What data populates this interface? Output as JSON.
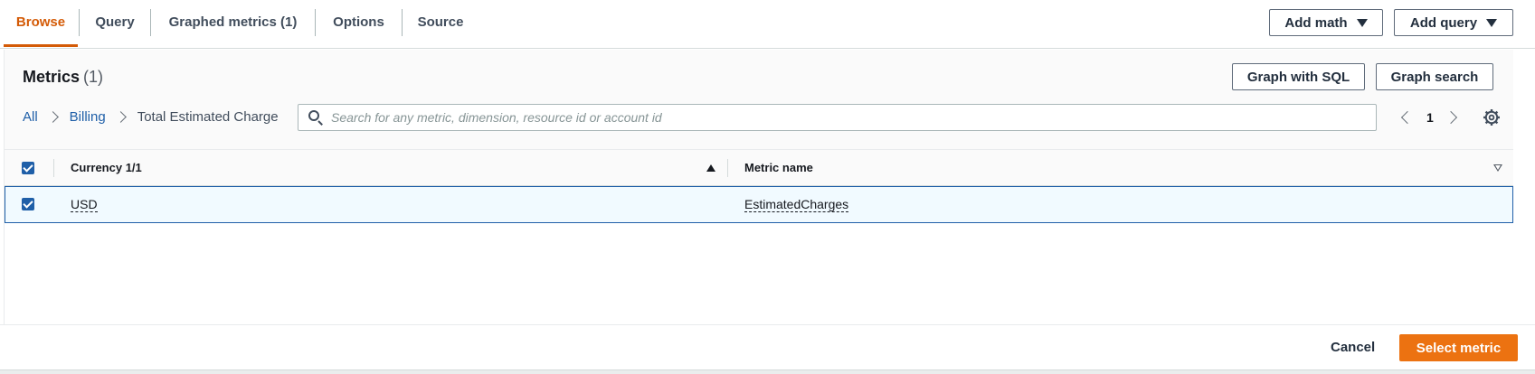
{
  "tabs": [
    {
      "label": "Browse",
      "active": true
    },
    {
      "label": "Query",
      "active": false
    },
    {
      "label": "Graphed metrics (1)",
      "active": false
    },
    {
      "label": "Options",
      "active": false
    },
    {
      "label": "Source",
      "active": false
    }
  ],
  "toolbar": {
    "add_math_label": "Add math",
    "add_query_label": "Add query"
  },
  "panel": {
    "title": "Metrics",
    "count": "(1)",
    "graph_with_sql_label": "Graph with SQL",
    "graph_search_label": "Graph search"
  },
  "breadcrumb": {
    "items": [
      "All",
      "Billing"
    ],
    "current": "Total Estimated Charge"
  },
  "search": {
    "placeholder": "Search for any metric, dimension, resource id or account id",
    "value": ""
  },
  "pagination": {
    "page": "1"
  },
  "table": {
    "columns": [
      "Currency 1/1",
      "Metric name"
    ],
    "rows": [
      {
        "currency": "USD",
        "metric_name": "EstimatedCharges",
        "selected": true
      }
    ]
  },
  "footer": {
    "cancel_label": "Cancel",
    "select_label": "Select metric"
  },
  "colors": {
    "accent": "#d45b07",
    "primary_button": "#ec7211",
    "link": "#1f5fa8",
    "selected_row_bg": "#f1faff"
  },
  "icons": {
    "search": "search-icon",
    "settings": "gear-icon",
    "prev": "chevron-left-icon",
    "next": "chevron-right-icon",
    "dropdown": "caret-down-icon"
  }
}
